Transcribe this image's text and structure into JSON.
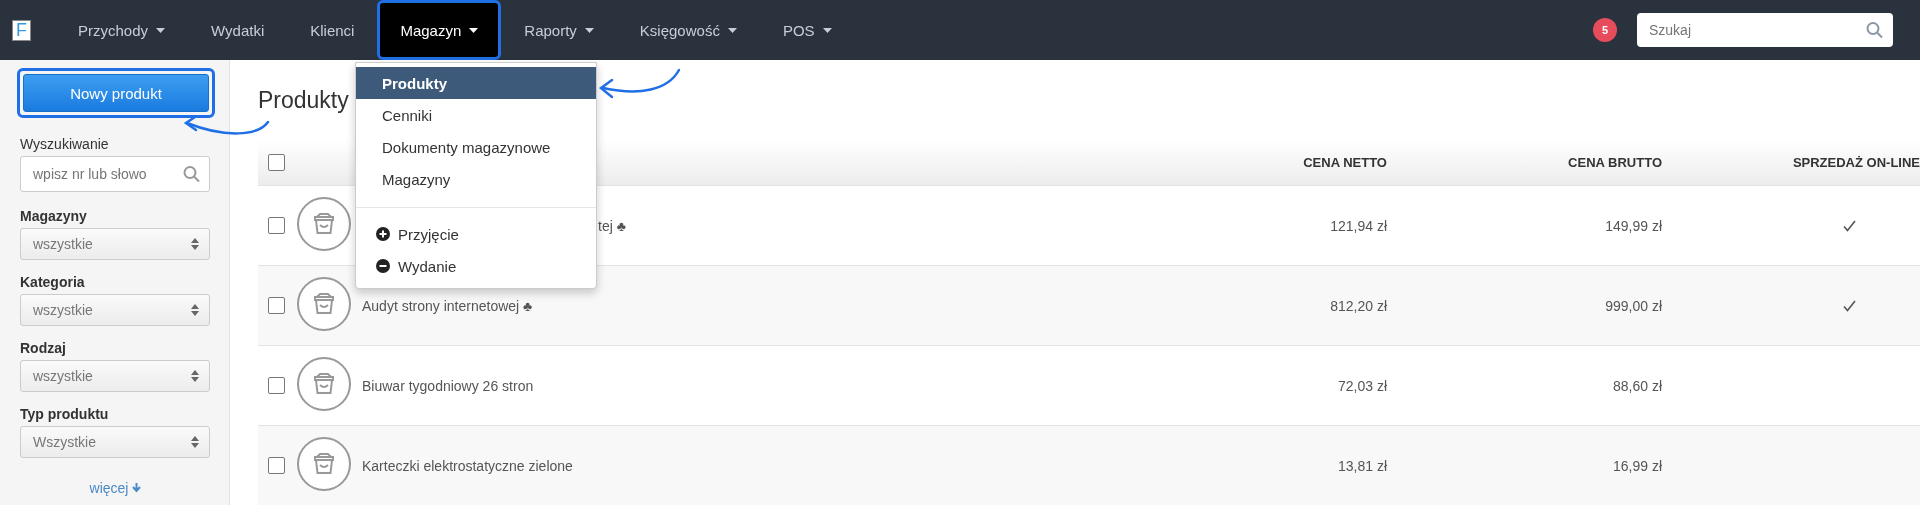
{
  "navbar": {
    "logo": "F",
    "items": [
      {
        "label": "Przychody",
        "has_menu": true,
        "selected": false,
        "highlighted": false
      },
      {
        "label": "Wydatki",
        "has_menu": false,
        "selected": false,
        "highlighted": false
      },
      {
        "label": "Klienci",
        "has_menu": false,
        "selected": false,
        "highlighted": false
      },
      {
        "label": "Magazyn",
        "has_menu": true,
        "selected": true,
        "highlighted": true
      },
      {
        "label": "Raporty",
        "has_menu": true,
        "selected": false,
        "highlighted": false
      },
      {
        "label": "Księgowość",
        "has_menu": true,
        "selected": false,
        "highlighted": false
      },
      {
        "label": "POS",
        "has_menu": true,
        "selected": false,
        "highlighted": false
      }
    ],
    "badge": "5",
    "search": {
      "placeholder": "Szukaj"
    }
  },
  "dropdown": {
    "links": [
      {
        "label": "Produkty",
        "selected": true
      },
      {
        "label": "Cenniki",
        "selected": false
      },
      {
        "label": "Dokumenty magazynowe",
        "selected": false
      },
      {
        "label": "Magazyny",
        "selected": false
      }
    ],
    "actions": [
      {
        "label": "Przyjęcie",
        "kind": "add"
      },
      {
        "label": "Wydanie",
        "kind": "remove"
      }
    ]
  },
  "sidebar": {
    "new_button": {
      "label": "Nowy produkt",
      "highlighted": true
    },
    "filters": [
      {
        "kind": "search",
        "label": "Wyszukiwanie",
        "placeholder": "wpisz nr lub słowo"
      },
      {
        "kind": "select",
        "label": "Magazyny",
        "value": "wszystkie"
      },
      {
        "kind": "select",
        "label": "Kategoria",
        "value": "wszystkie"
      },
      {
        "kind": "select",
        "label": "Rodzaj",
        "value": "wszystkie"
      },
      {
        "kind": "select",
        "label": "Typ produktu",
        "value": "Wszystkie"
      }
    ],
    "more_link": "więcej"
  },
  "page": {
    "title": "Produkty"
  },
  "table": {
    "columns": [
      "CENA NETTO",
      "CENA BRUTTO",
      "SPRZEDAŻ ON-LINE"
    ],
    "header_checked": false,
    "rows": [
      {
        "name": "tej ♣",
        "partly_hidden": true,
        "checked": false,
        "net": "121,94 zł",
        "gross": "149,99 zł",
        "online": true
      },
      {
        "name": "Audyt strony internetowej ♣",
        "partly_hidden": false,
        "checked": false,
        "net": "812,20 zł",
        "gross": "999,00 zł",
        "online": true
      },
      {
        "name": "Biuwar tygodniowy 26 stron",
        "partly_hidden": false,
        "checked": false,
        "net": "72,03 zł",
        "gross": "88,60 zł",
        "online": false
      },
      {
        "name": "Karteczki elektrostatyczne zielone",
        "partly_hidden": false,
        "checked": false,
        "net": "13,81 zł",
        "gross": "16,99 zł",
        "online": false
      }
    ]
  }
}
